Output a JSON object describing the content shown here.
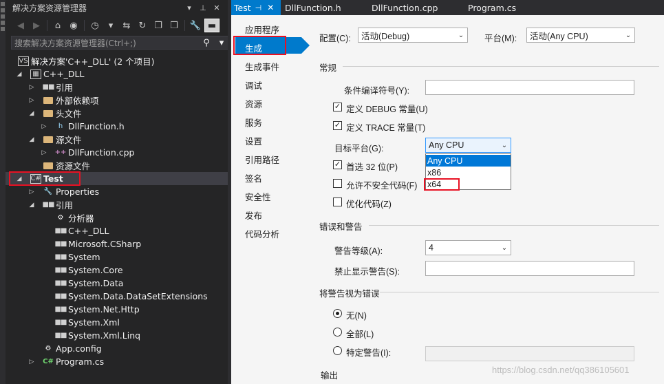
{
  "solution_explorer": {
    "title": "解决方案资源管理器",
    "title_icons": [
      "dropdown-icon",
      "pin-icon",
      "close-icon"
    ],
    "title_glyphs": [
      "▾",
      "⊥",
      "✕"
    ],
    "toolbar_icons": [
      "back-icon",
      "forward-icon",
      "home-icon",
      "vs-icon",
      "history-icon",
      "dropdown-icon",
      "sync-icon",
      "refresh-icon",
      "collapse-icon",
      "copy-icon",
      "properties-icon",
      "preview-icon"
    ],
    "toolbar_glyphs": [
      "◀",
      "▶",
      "⌂",
      "◉",
      "◷",
      "▾",
      "⇆",
      "↻",
      "❐",
      "❒",
      "🔧",
      "▬"
    ],
    "search_placeholder": "搜索解决方案资源管理器(Ctrl+;)",
    "search_glyphs": {
      "icon": "⚲",
      "menu": "▾"
    },
    "tree": [
      {
        "label": "解决方案'C++_DLL' (2 个项目)",
        "icon": "solution-icon",
        "glyph": "VS",
        "arrow": "",
        "level": 0
      },
      {
        "label": "C++_DLL",
        "icon": "cpp-project-icon",
        "glyph": "▦",
        "arrow": "◢",
        "level": 0
      },
      {
        "label": "引用",
        "icon": "references-icon",
        "glyph": "■■",
        "arrow": "▷",
        "level": 1
      },
      {
        "label": "外部依赖项",
        "icon": "folder-icon",
        "glyph": "",
        "arrow": "▷",
        "level": 1
      },
      {
        "label": "头文件",
        "icon": "folder-icon",
        "glyph": "",
        "arrow": "◢",
        "level": 1
      },
      {
        "label": "DllFunction.h",
        "icon": "header-file-icon",
        "glyph": "h",
        "arrow": "▷",
        "level": 2
      },
      {
        "label": "源文件",
        "icon": "folder-icon",
        "glyph": "",
        "arrow": "◢",
        "level": 1
      },
      {
        "label": "DllFunction.cpp",
        "icon": "cpp-file-icon",
        "glyph": "++",
        "arrow": "▷",
        "level": 2
      },
      {
        "label": "资源文件",
        "icon": "folder-icon",
        "glyph": "",
        "arrow": "",
        "level": 1
      },
      {
        "label": "Test",
        "icon": "cs-project-icon",
        "glyph": "C#",
        "arrow": "◢",
        "level": 0
      },
      {
        "label": "Properties",
        "icon": "wrench-icon",
        "glyph": "🔧",
        "arrow": "▷",
        "level": 1
      },
      {
        "label": "引用",
        "icon": "references-icon",
        "glyph": "■■",
        "arrow": "◢",
        "level": 1
      },
      {
        "label": "分析器",
        "icon": "analyzer-icon",
        "glyph": "⚙",
        "arrow": "",
        "level": 2
      },
      {
        "label": "C++_DLL",
        "icon": "reference-icon",
        "glyph": "■■",
        "arrow": "",
        "level": 2
      },
      {
        "label": "Microsoft.CSharp",
        "icon": "reference-icon",
        "glyph": "■■",
        "arrow": "",
        "level": 2
      },
      {
        "label": "System",
        "icon": "reference-icon",
        "glyph": "■■",
        "arrow": "",
        "level": 2
      },
      {
        "label": "System.Core",
        "icon": "reference-icon",
        "glyph": "■■",
        "arrow": "",
        "level": 2
      },
      {
        "label": "System.Data",
        "icon": "reference-icon",
        "glyph": "■■",
        "arrow": "",
        "level": 2
      },
      {
        "label": "System.Data.DataSetExtensions",
        "icon": "reference-icon",
        "glyph": "■■",
        "arrow": "",
        "level": 2
      },
      {
        "label": "System.Net.Http",
        "icon": "reference-icon",
        "glyph": "■■",
        "arrow": "",
        "level": 2
      },
      {
        "label": "System.Xml",
        "icon": "reference-icon",
        "glyph": "■■",
        "arrow": "",
        "level": 2
      },
      {
        "label": "System.Xml.Linq",
        "icon": "reference-icon",
        "glyph": "■■",
        "arrow": "",
        "level": 2
      },
      {
        "label": "App.config",
        "icon": "config-file-icon",
        "glyph": "⚙",
        "arrow": "",
        "level": 1
      },
      {
        "label": "Program.cs",
        "icon": "cs-file-icon",
        "glyph": "C#",
        "arrow": "▷",
        "level": 1
      }
    ]
  },
  "tabs": [
    {
      "label": "Test",
      "active": true,
      "pin": "⊣",
      "close": "✕"
    },
    {
      "label": "DllFunction.h",
      "active": false
    },
    {
      "label": "DllFunction.cpp",
      "active": false
    },
    {
      "label": "Program.cs",
      "active": false
    }
  ],
  "nav": [
    "应用程序",
    "生成",
    "生成事件",
    "调试",
    "资源",
    "服务",
    "设置",
    "引用路径",
    "签名",
    "安全性",
    "发布",
    "代码分析"
  ],
  "nav_selected_index": 1,
  "build": {
    "config_label": "配置(C):",
    "config_value": "活动(Debug)",
    "platform_label": "平台(M):",
    "platform_value": "活动(Any CPU)",
    "section_general": "常规",
    "cond_symbols_label": "条件编译符号(Y):",
    "cond_symbols_value": "",
    "define_debug_label": "定义 DEBUG 常量(U)",
    "define_debug_checked": true,
    "define_trace_label": "定义 TRACE 常量(T)",
    "define_trace_checked": true,
    "target_label": "目标平台(G):",
    "target_value": "Any CPU",
    "target_options": [
      "Any CPU",
      "x86",
      "x64"
    ],
    "target_highlighted": "Any CPU",
    "prefer32_label": "首选 32 位(P)",
    "prefer32_checked": true,
    "unsafe_label": "允许不安全代码(F)",
    "unsafe_checked": false,
    "optimize_label": "优化代码(Z)",
    "optimize_checked": false,
    "section_errors": "错误和警告",
    "warning_level_label": "警告等级(A):",
    "warning_level_value": "4",
    "suppress_label": "禁止显示警告(S):",
    "suppress_value": "",
    "section_treat": "将警告视为错误",
    "radio_none": "无(N)",
    "radio_all": "全部(L)",
    "radio_specific": "特定警告(I):",
    "radio_selected": "none",
    "section_output": "输出"
  },
  "watermark": "https://blog.csdn.net/qq386105601",
  "chevron_glyph": "⌄",
  "check_glyph": "✓"
}
